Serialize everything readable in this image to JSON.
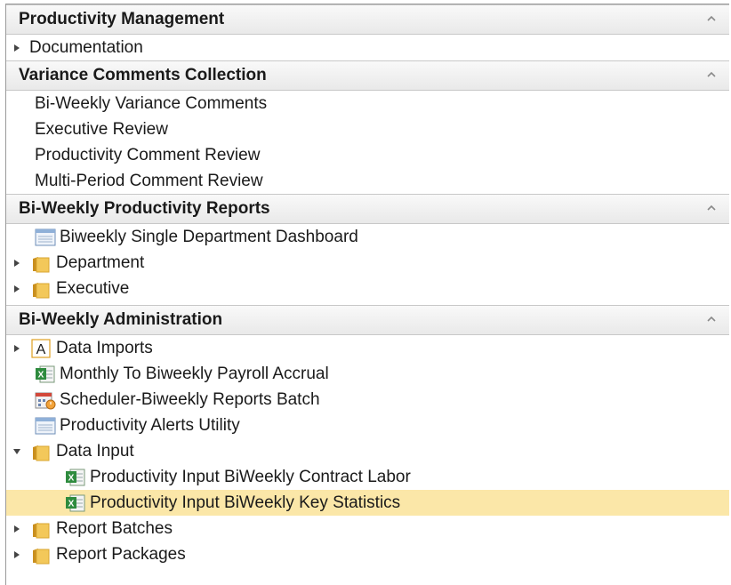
{
  "sections": [
    {
      "title": "Productivity Management",
      "items": [
        {
          "label": "Documentation",
          "expander": "collapsed",
          "icon": "none",
          "level": 0
        }
      ]
    },
    {
      "title": "Variance Comments Collection",
      "items": [
        {
          "label": "Bi-Weekly Variance Comments",
          "expander": "none",
          "icon": "none",
          "level": 0
        },
        {
          "label": "Executive Review",
          "expander": "none",
          "icon": "none",
          "level": 0
        },
        {
          "label": "Productivity Comment Review",
          "expander": "none",
          "icon": "none",
          "level": 0
        },
        {
          "label": "Multi-Period Comment Review",
          "expander": "none",
          "icon": "none",
          "level": 0
        }
      ]
    },
    {
      "title": "Bi-Weekly Productivity Reports",
      "items": [
        {
          "label": "Biweekly Single Department Dashboard",
          "expander": "none",
          "icon": "dashboard-icon",
          "level": 0
        },
        {
          "label": "Department",
          "expander": "collapsed",
          "icon": "folder-icon",
          "level": 0
        },
        {
          "label": "Executive",
          "expander": "collapsed",
          "icon": "folder-icon",
          "level": 0
        }
      ]
    },
    {
      "title": "Bi-Weekly Administration",
      "items": [
        {
          "label": "Data Imports",
          "expander": "collapsed",
          "icon": "letter-a-icon",
          "level": 0
        },
        {
          "label": "Monthly To Biweekly Payroll Accrual",
          "expander": "none",
          "icon": "excel-icon",
          "level": 0
        },
        {
          "label": "Scheduler-Biweekly Reports Batch",
          "expander": "none",
          "icon": "scheduler-icon",
          "level": 0
        },
        {
          "label": "Productivity Alerts Utility",
          "expander": "none",
          "icon": "dashboard-icon",
          "level": 0
        },
        {
          "label": "Data Input",
          "expander": "expanded",
          "icon": "folder-icon",
          "level": 0
        },
        {
          "label": "Productivity Input BiWeekly Contract Labor",
          "expander": "none",
          "icon": "excel-icon",
          "level": 1
        },
        {
          "label": "Productivity Input BiWeekly Key Statistics",
          "expander": "none",
          "icon": "excel-icon",
          "level": 1,
          "selected": true
        },
        {
          "label": "Report Batches",
          "expander": "collapsed",
          "icon": "folder-icon",
          "level": 0
        },
        {
          "label": "Report Packages",
          "expander": "collapsed",
          "icon": "folder-icon",
          "level": 0
        }
      ]
    }
  ],
  "colors": {
    "selected_row": "#fbe7a8",
    "folder": "#e9b83a",
    "excel": "#2e8b3e",
    "arrow": "#444444"
  }
}
